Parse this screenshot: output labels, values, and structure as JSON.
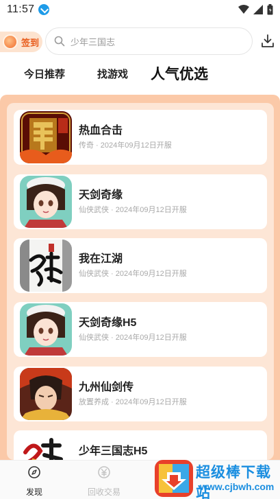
{
  "status_bar": {
    "time": "11:57"
  },
  "topbar": {
    "signin_label": "签到",
    "search_placeholder": "少年三国志"
  },
  "tabs": [
    {
      "label": "今日推荐"
    },
    {
      "label": "找游戏"
    },
    {
      "label": "人气优选"
    }
  ],
  "games": [
    {
      "name": "热血合击",
      "meta": "传奇 · 2024年09月12日开服",
      "icon": "dragon-logo-icon"
    },
    {
      "name": "天剑奇缘",
      "meta": "仙侠武侠 · 2024年09月12日开服",
      "icon": "anime-girl-icon"
    },
    {
      "name": "我在江湖",
      "meta": "仙侠武侠 · 2024年09月12日开服",
      "icon": "calligraphy-icon"
    },
    {
      "name": "天剑奇缘H5",
      "meta": "仙侠武侠 · 2024年09月12日开服",
      "icon": "anime-girl-icon"
    },
    {
      "name": "九州仙剑传",
      "meta": "放置养成 · 2024年09月12日开服",
      "icon": "warrior-icon"
    },
    {
      "name": "少年三国志H5",
      "meta": "",
      "icon": "three-kingdoms-icon"
    }
  ],
  "bottom_nav": [
    {
      "label": "发现"
    },
    {
      "label": "回收交易"
    }
  ],
  "watermark": {
    "title": "超级棒下载站",
    "url": "www.cjbwh.com"
  },
  "colors": {
    "accent": "#e85c1c",
    "panel_bg": "#fbc9a8",
    "panel_inner": "#fde6d6",
    "watermark_blue": "#1a8ee0"
  }
}
